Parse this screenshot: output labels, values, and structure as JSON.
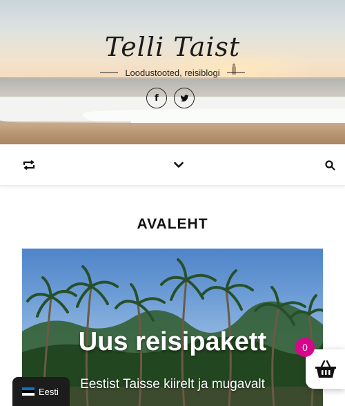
{
  "header": {
    "site_title": "Telli Taist",
    "tagline": "Loodustooted, reisiblogi",
    "social": [
      {
        "icon": "facebook-icon",
        "glyph": "f"
      },
      {
        "icon": "twitter-icon"
      }
    ]
  },
  "nav": {
    "left_icon": "shuffle-arrows-icon",
    "center_icon": "chevron-down-icon",
    "right_icon": "search-icon"
  },
  "main": {
    "page_heading": "AVALEHT",
    "hero": {
      "title": "Uus reisipakett",
      "subtitle": "Eestist Taisse kiirelt ja mugavalt"
    }
  },
  "language_switcher": {
    "label": "Eesti",
    "flag_colors": [
      "#0072ce",
      "#000000",
      "#ffffff"
    ]
  },
  "cart": {
    "count": "0",
    "badge_color": "#d6058b",
    "icon": "basket-icon"
  }
}
